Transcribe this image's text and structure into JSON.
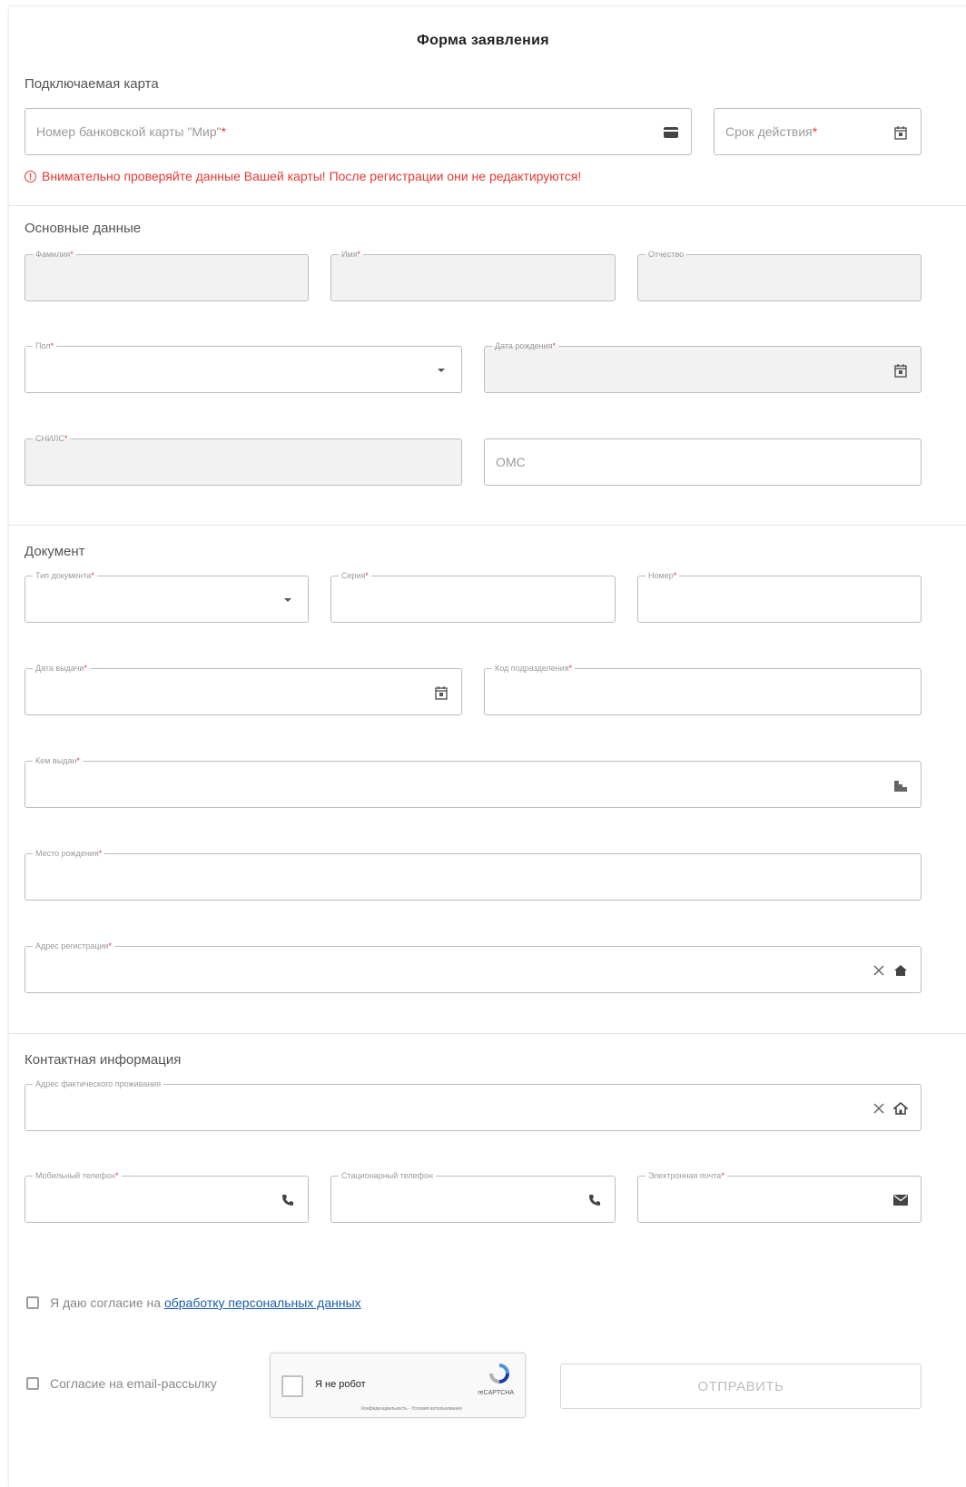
{
  "form_title": "Форма заявления",
  "sections": {
    "card": "Подключаемая карта",
    "main": "Основные данные",
    "document": "Документ",
    "contact": "Контактная информация"
  },
  "card": {
    "number_placeholder": "Номер банковской карты \"Мир\"",
    "expiry_placeholder": "Срок действия",
    "warning": "Внимательно проверяйте данные Вашей карты! После регистрации они не редактируются!"
  },
  "main": {
    "surname": "Фамилия",
    "name": "Имя",
    "patronymic": "Отчество",
    "gender": "Пол",
    "birth_date": "Дата рождения",
    "snils": "СНИЛС",
    "oms_placeholder": "ОМС"
  },
  "document": {
    "type": "Тип документа",
    "series": "Серия",
    "number": "Номер",
    "issue_date": "Дата выдачи",
    "division_code": "Код подразделения",
    "issued_by": "Кем выдан",
    "birth_place": "Место рождения",
    "reg_address": "Адрес регистрации"
  },
  "contact": {
    "actual_address": "Адрес фактического проживания",
    "mobile": "Мобильный телефон",
    "landline": "Стационарный телефон",
    "email": "Электронная почта"
  },
  "consent": {
    "prefix": "Я даю согласие на",
    "link": "обработку персональных данных",
    "email_newsletter": "Согласие на email-рассылку"
  },
  "captcha": {
    "label": "Я не робот",
    "brand": "reCAPTCHA",
    "terms": "Конфиденциальность - Условия использования"
  },
  "submit_label": "ОТПРАВИТЬ",
  "required_mark": "*",
  "colors": {
    "required": "#e53935",
    "link": "#1a5dad",
    "disabled_bg": "#f2f2f2"
  },
  "icons": [
    "card-icon",
    "calendar-icon",
    "dropdown-arrow-icon",
    "building-icon",
    "clear-icon",
    "home-icon",
    "home-outline-icon",
    "phone-icon",
    "email-icon",
    "recaptcha-logo-icon",
    "warning-icon"
  ]
}
